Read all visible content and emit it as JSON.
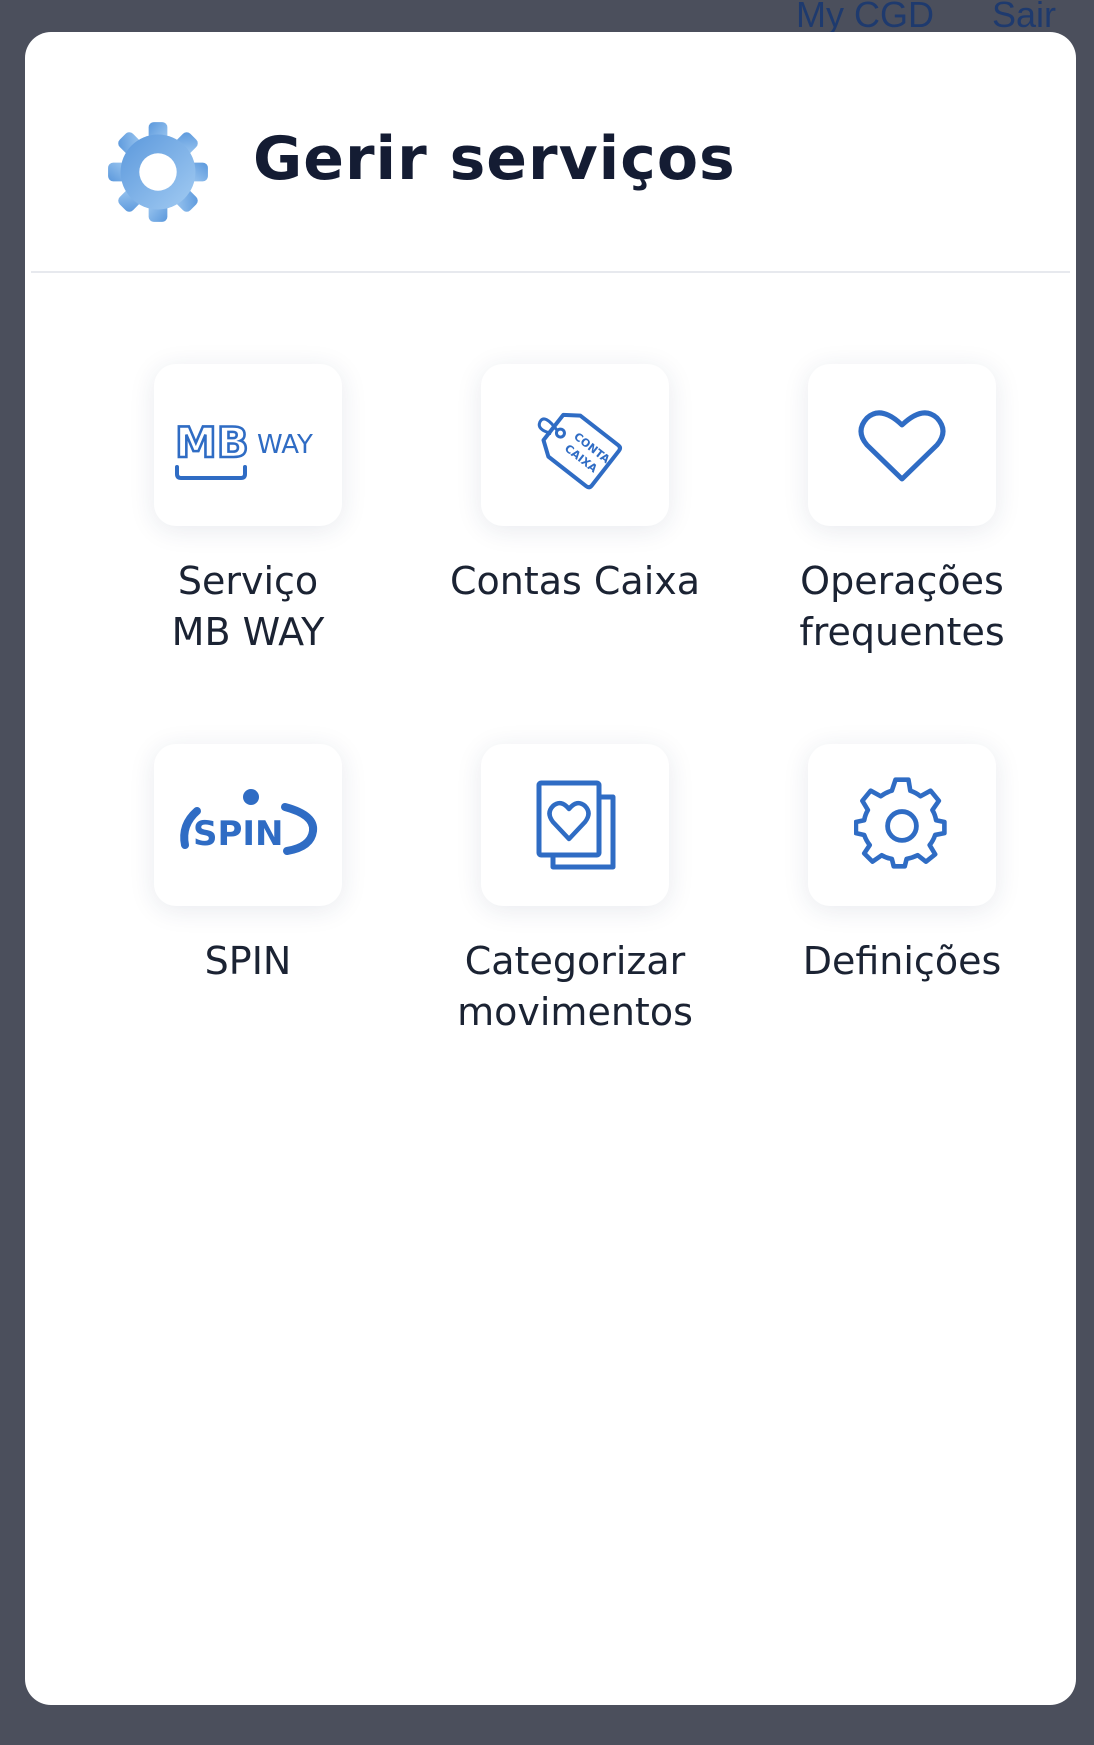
{
  "background": {
    "links": [
      "My CGD",
      "Sair"
    ]
  },
  "modal": {
    "title": "Gerir serviços",
    "header_icon": "gear-icon"
  },
  "tiles": [
    {
      "id": "mbway",
      "icon": "mbway-logo-icon",
      "logo_main": "MB",
      "logo_sub": "WAY",
      "label_lines": [
        "Serviço",
        "MB WAY"
      ]
    },
    {
      "id": "contas-caixa",
      "icon": "tag-icon",
      "tag_text": [
        "CONTA",
        "CAIXA"
      ],
      "label_lines": [
        "Contas Caixa"
      ]
    },
    {
      "id": "operacoes-frequentes",
      "icon": "heart-icon",
      "label_lines": [
        "Operações",
        "frequentes"
      ]
    },
    {
      "id": "spin",
      "icon": "spin-logo-icon",
      "logo_text": "SPIN",
      "label_lines": [
        "SPIN"
      ]
    },
    {
      "id": "categorizar-movimentos",
      "icon": "heart-cards-icon",
      "label_lines": [
        "Categorizar",
        "movimentos"
      ]
    },
    {
      "id": "definicoes",
      "icon": "gear-icon",
      "label_lines": [
        "Definições"
      ]
    }
  ],
  "colors": {
    "accent": "#2f6cc4",
    "header_icon": "#7fb3ea",
    "title": "#141c33",
    "overlay": "#4b4f5c"
  }
}
